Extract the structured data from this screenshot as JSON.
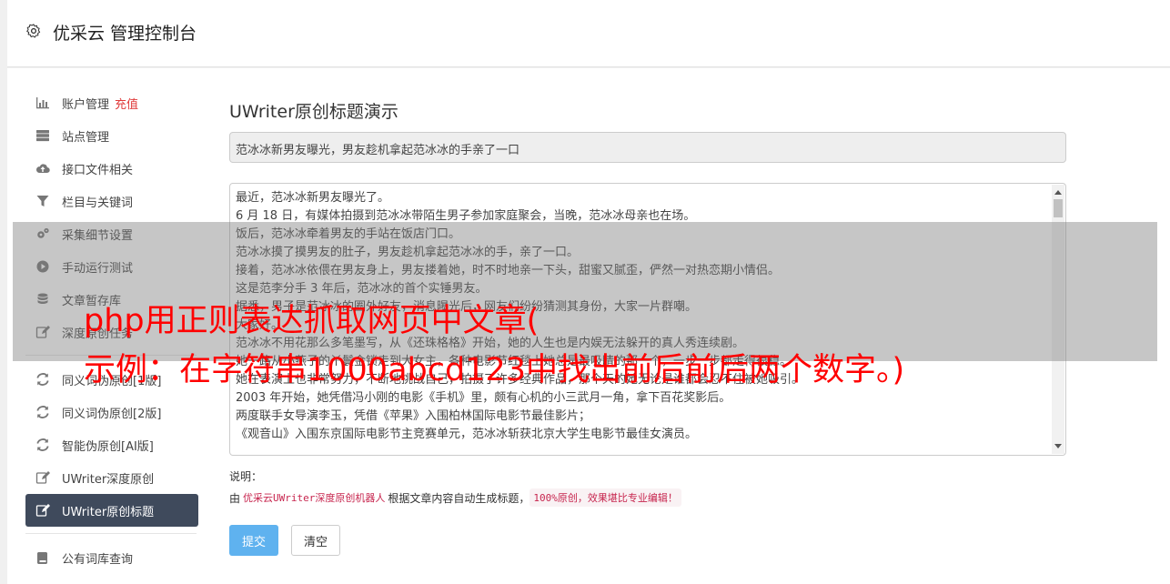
{
  "header": {
    "title": "优采云 管理控制台",
    "icon": "gear-icon"
  },
  "sidebar": {
    "group1": [
      {
        "label": "账户管理",
        "badge": "充值",
        "icon": "bar-chart-icon"
      },
      {
        "label": "站点管理",
        "icon": "server-icon"
      },
      {
        "label": "接口文件相关",
        "icon": "cloud-upload-icon"
      },
      {
        "label": "栏目与关键词",
        "icon": "filter-icon"
      },
      {
        "label": "采集细节设置",
        "icon": "cogs-icon"
      },
      {
        "label": "手动运行测试",
        "icon": "play-circle-icon"
      },
      {
        "label": "文章暂存库",
        "icon": "database-icon"
      },
      {
        "label": "深度原创任务",
        "icon": "edit-icon"
      }
    ],
    "group2": [
      {
        "label": "同义词伪原创[1版]",
        "icon": "refresh-icon"
      },
      {
        "label": "同义词伪原创[2版]",
        "icon": "refresh-icon"
      },
      {
        "label": "智能伪原创[AI版]",
        "icon": "refresh-icon"
      },
      {
        "label": "UWriter深度原创",
        "icon": "edit-icon"
      },
      {
        "label": "UWriter原创标题",
        "icon": "edit-icon",
        "active": true
      }
    ],
    "group3": [
      {
        "label": "公有词库查询",
        "icon": "book-icon"
      }
    ]
  },
  "content": {
    "heading": "UWriter原创标题演示",
    "title_value": "范冰冰新男友曝光，男友趁机拿起范冰冰的手亲了一口",
    "article_lines": [
      "最近，范冰冰新男友曝光了。",
      "6 月 18 日，有媒体拍摄到范冰冰带陌生男子参加家庭聚会，当晚，范冰冰母亲也在场。",
      "饭后，范冰冰牵着男友的手站在饭店门口。",
      "范冰冰摸了摸男友的肚子，男友趁机拿起范冰冰的手，亲了一口。",
      "接着，范冰冰依偎在男友身上，男友搂着她，时不时地亲一下头，甜蜜又腻歪，俨然一对热恋期小情侣。",
      "这是范李分手 3 年后，范冰冰的首个实锤男友。",
      "据悉，男子是范冰冰的圈外好友，消息曝光后，网友们纷纷猜测其身份，大家一片群嘲。",
      "大家好。",
      "范冰冰不用花那么多笔墨写，从《还珠格格》开始，她的人生也是内娱无法躲开的真人秀连续剧。",
      "她一路从小燕子的丫鬟金锁走到大女主，各种电影节红毯上她总是最吸睛的那一个，一步一步都走得很稳。",
      "她在表演上也非常努力，不断地挑战自己，拍摄了许多经典作品，那个天的她无论是谁都会忍不住被她吸引。",
      "2003 年开始，她凭借冯小刚的电影《手机》里，颇有心机的小三武月一角，拿下百花奖影后。",
      "两度联手女导演李玉，凭借《苹果》入围柏林国际电影节最佳影片；",
      "《观音山》入围东京国际电影节主竞赛单元，范冰冰斩获北京大学生电影节最佳女演员。"
    ],
    "note_label": "说明：",
    "note_prefix": "由",
    "note_code1": "优采云UWriter深度原创机器人",
    "note_middle": "根据文章内容自动生成标题，",
    "note_code2": "100%原创，效果堪比专业编辑！",
    "submit_label": "提交",
    "clear_label": "清空"
  },
  "overlay": {
    "line1": "php用正则表达抓取网页中文章(",
    "line2": "示例：在字符串1000abcd123中找出前后前后两个数字。)"
  }
}
